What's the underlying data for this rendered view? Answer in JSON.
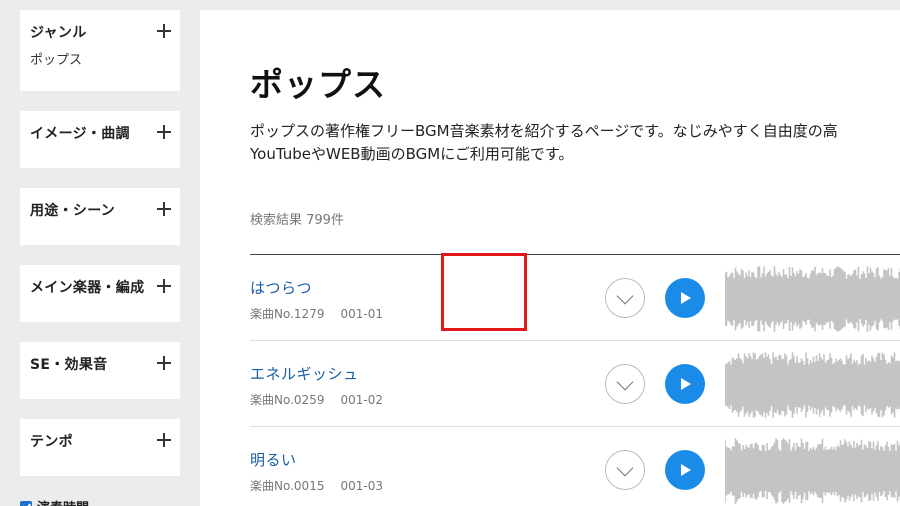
{
  "sidebar": {
    "filters": [
      {
        "label": "ジャンル",
        "sub": "ポップス"
      },
      {
        "label": "イメージ・曲調",
        "sub": ""
      },
      {
        "label": "用途・シーン",
        "sub": ""
      },
      {
        "label": "メイン楽器・編成",
        "sub": ""
      },
      {
        "label": "SE・効果音",
        "sub": ""
      },
      {
        "label": "テンポ",
        "sub": ""
      }
    ],
    "checkbox_label": "演奏時間"
  },
  "main": {
    "title": "ポップス",
    "description_line1": "ポップスの著作権フリーBGM音楽素材を紹介するページです。なじみやすく自由度の高",
    "description_line2": "YouTubeやWEB動画のBGMにご利用可能です。",
    "result_count": "検索結果 799件",
    "tracks": [
      {
        "title": "はつらつ",
        "number": "楽曲No.1279",
        "code": "001-01"
      },
      {
        "title": "エネルギッシュ",
        "number": "楽曲No.0259",
        "code": "001-02"
      },
      {
        "title": "明るい",
        "number": "楽曲No.0015",
        "code": "001-03"
      }
    ]
  },
  "colors": {
    "accent": "#1a8ce8",
    "link": "#1a5ea8",
    "highlight": "#e01818",
    "waveform": "#c4c4c4"
  }
}
